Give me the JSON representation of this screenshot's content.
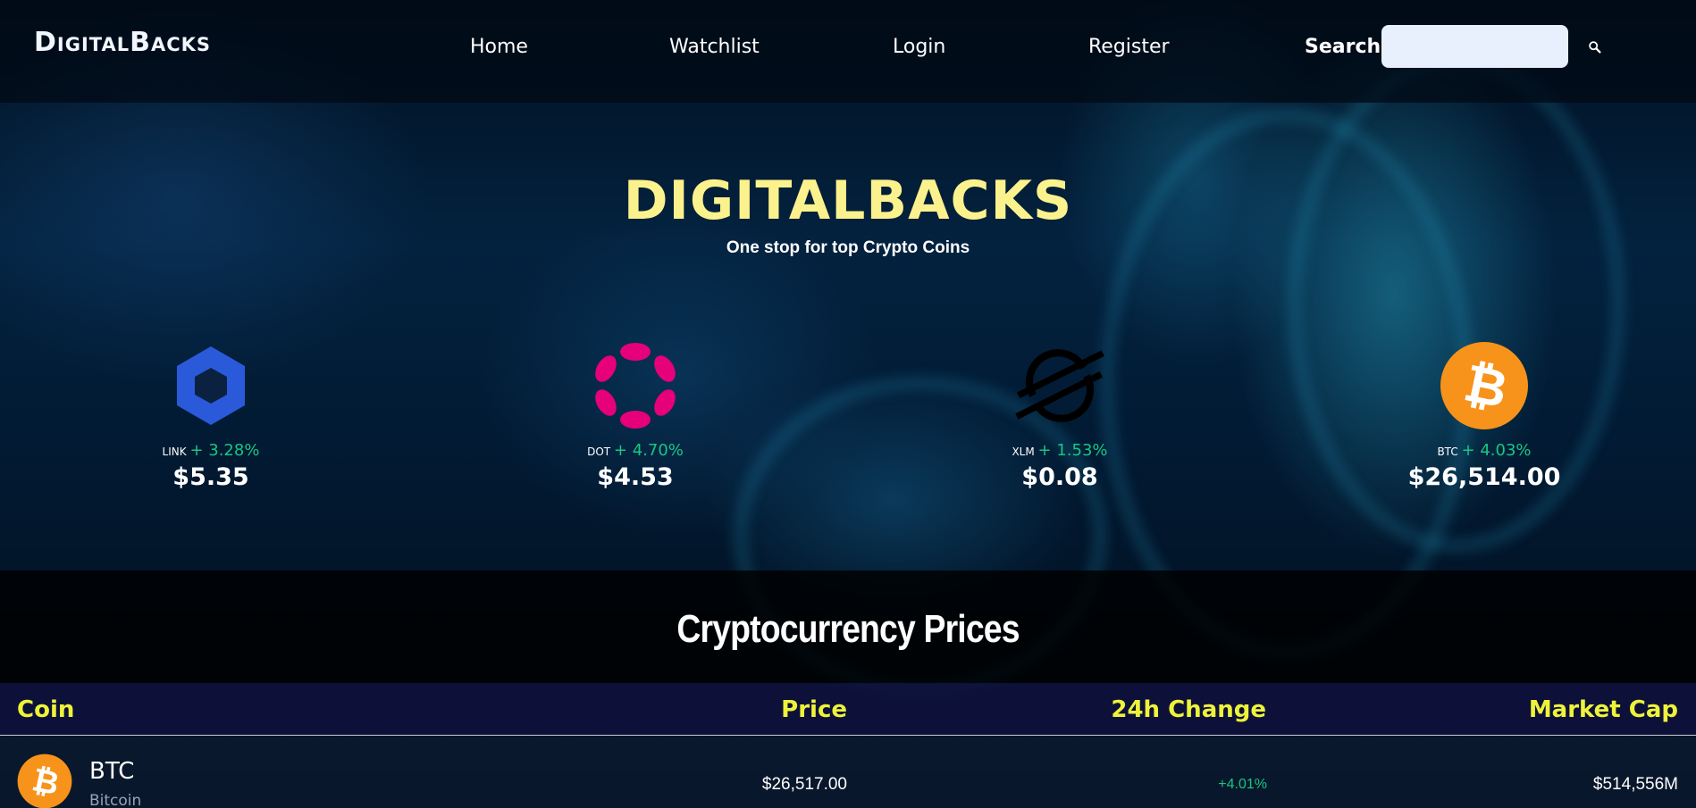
{
  "brand": {
    "logo": "DigitalBacks"
  },
  "nav": {
    "links": [
      "Home",
      "Watchlist",
      "Login",
      "Register"
    ],
    "search_label": "Search",
    "search_placeholder": "",
    "search_icon": "search-icon"
  },
  "hero": {
    "title": "DIGITALBACKS",
    "subtitle": "One stop for top Crypto Coins",
    "coins": [
      {
        "symbol": "LINK",
        "change": "+ 3.28%",
        "price": "$5.35",
        "icon": "chainlink-icon",
        "color": "#2a5ada"
      },
      {
        "symbol": "DOT",
        "change": "+ 4.70%",
        "price": "$4.53",
        "icon": "polkadot-icon",
        "color": "#e6007a"
      },
      {
        "symbol": "XLM",
        "change": "+ 1.53%",
        "price": "$0.08",
        "icon": "stellar-icon",
        "color": "#000000"
      },
      {
        "symbol": "BTC",
        "change": "+ 4.03%",
        "price": "$26,514.00",
        "icon": "bitcoin-icon",
        "color": "#f7931a"
      }
    ]
  },
  "prices": {
    "title": "Cryptocurrency Prices",
    "columns": [
      "Coin",
      "Price",
      "24h Change",
      "Market Cap"
    ],
    "rows": [
      {
        "symbol": "BTC",
        "name": "Bitcoin",
        "price": "$26,517.00",
        "change": "+4.01%",
        "market_cap": "$514,556M",
        "icon": "bitcoin-icon"
      }
    ]
  },
  "colors": {
    "accent_yellow": "#fbf28e",
    "header_yellow": "#eef33a",
    "positive_green": "#16c784"
  }
}
